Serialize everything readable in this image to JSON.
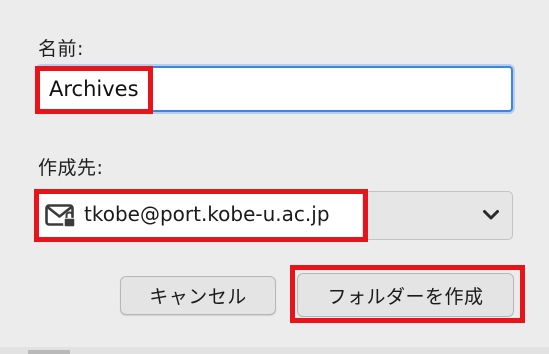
{
  "dialog": {
    "name_label": "名前:",
    "name_value": "Archives",
    "destination_label": "作成先:",
    "destination_value": "tkobe@port.kobe-u.ac.jp",
    "cancel_label": "キャンセル",
    "create_label": "フォルダーを作成"
  },
  "icons": {
    "account": "mail-lock-icon",
    "dropdown": "chevron-down-icon"
  },
  "colors": {
    "highlight": "#e8141c",
    "focus_ring": "#3a86e0",
    "background": "#ececec"
  }
}
